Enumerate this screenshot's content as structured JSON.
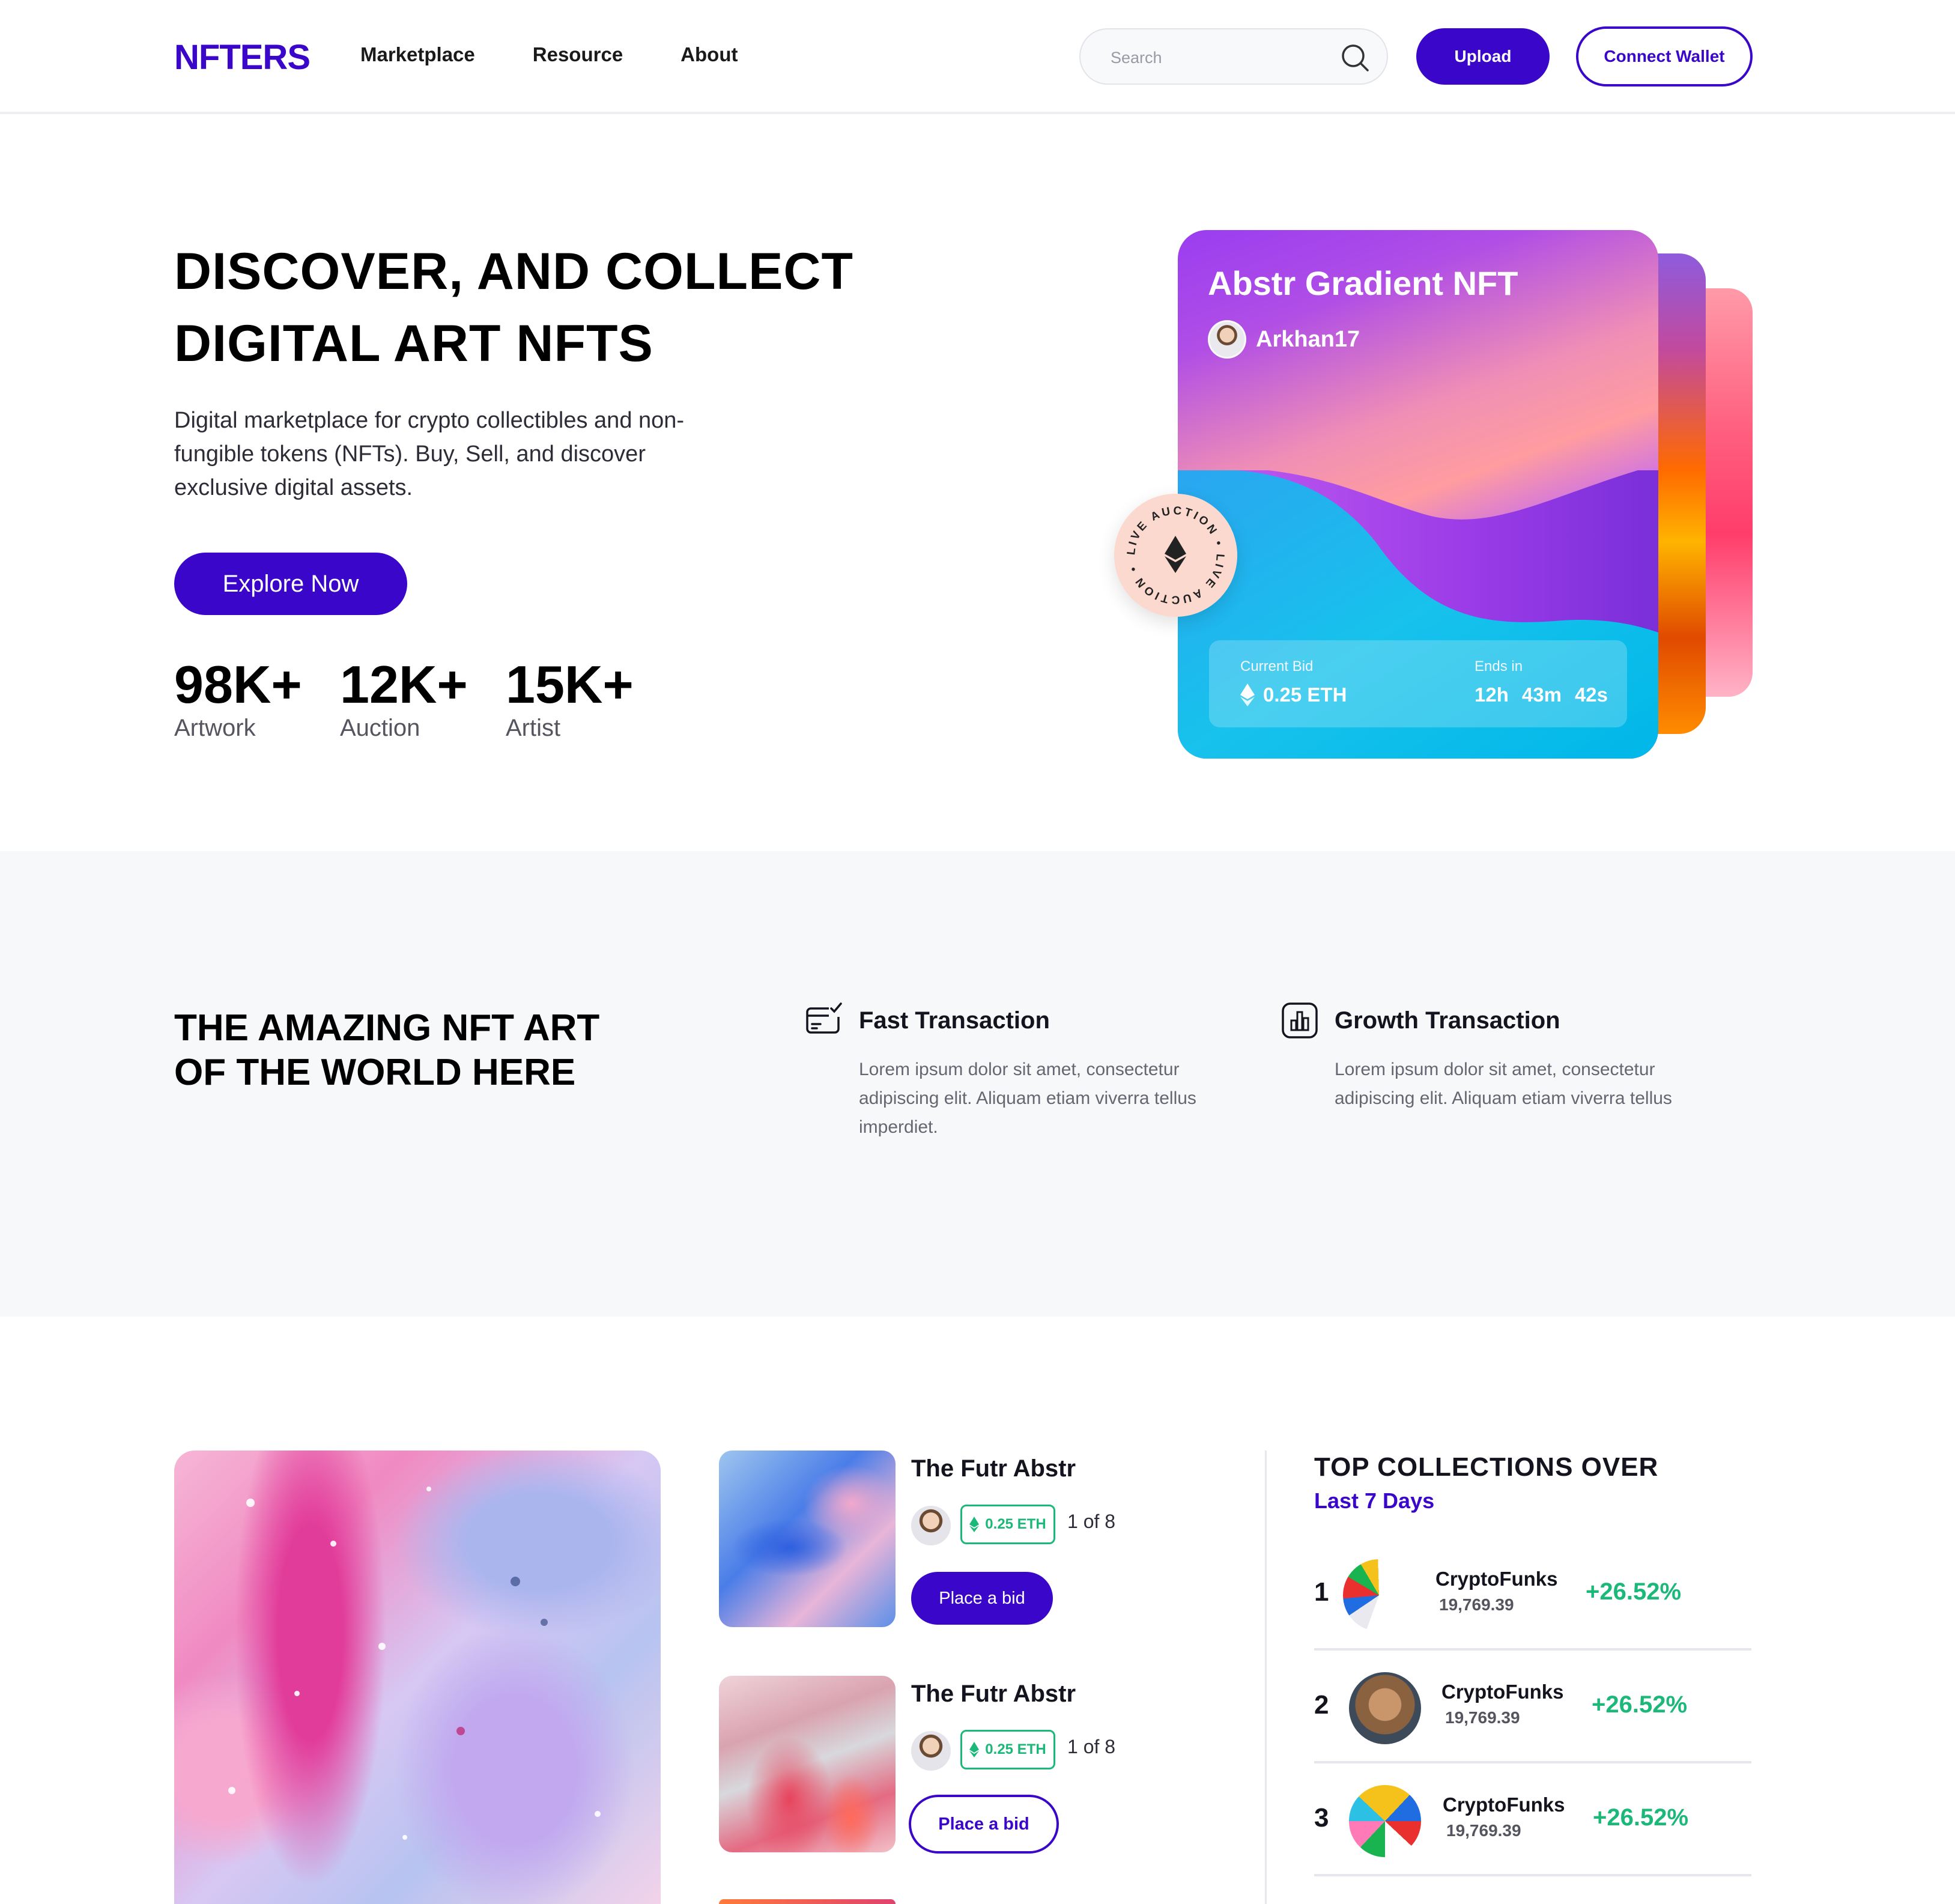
{
  "header": {
    "logo": "NFTERS",
    "nav": [
      "Marketplace",
      "Resource",
      "About"
    ],
    "search_placeholder": "Search",
    "upload_label": "Upload",
    "wallet_label": "Connect Wallet",
    "brand_color": "#3a06c9"
  },
  "hero": {
    "title_line1": "DISCOVER, AND COLLECT",
    "title_line2": "DIGITAL ART NFTS",
    "description": "Digital marketplace for crypto collectibles and non-fungible tokens (NFTs). Buy, Sell, and discover exclusive digital assets.",
    "cta_label": "Explore Now",
    "stats": [
      {
        "value": "98K+",
        "label": "Artwork"
      },
      {
        "value": "12K+",
        "label": "Auction"
      },
      {
        "value": "15K+",
        "label": "Artist"
      }
    ],
    "card": {
      "title": "Abstr Gradient NFT",
      "username": "Arkhan17",
      "current_bid_label": "Current Bid",
      "current_bid_value": "0.25 ETH",
      "ends_label": "Ends in",
      "ends_h": "12h",
      "ends_m": "43m",
      "ends_s": "42s",
      "badge_text": "LIVE AUCTION • LIVE AUCTION •"
    }
  },
  "features": {
    "title_line1": "THE AMAZING NFT ART",
    "title_line2": "OF THE WORLD HERE",
    "items": [
      {
        "name": "Fast Transaction",
        "icon": "card-check-icon",
        "desc": "Lorem ipsum dolor sit amet, consectetur adipiscing elit. Aliquam etiam viverra tellus imperdiet."
      },
      {
        "name": "Growth Transaction",
        "icon": "bar-chart-icon",
        "desc": "Lorem ipsum dolor sit amet, consectetur adipiscing elit. Aliquam etiam viverra tellus"
      }
    ]
  },
  "nft_list": [
    {
      "name": "The Futr Abstr",
      "price": "0.25 ETH",
      "count": "1 of 8",
      "bid_label": "Place a bid"
    },
    {
      "name": "The Futr Abstr",
      "price": "0.25 ETH",
      "count": "1 of 8",
      "bid_label": "Place a bid"
    }
  ],
  "top_collections": {
    "title": "TOP COLLECTIONS OVER",
    "subtitle": "Last 7 Days",
    "items": [
      {
        "rank": "1",
        "name": "CryptoFunks",
        "volume": "19,769.39",
        "change": "+26.52%"
      },
      {
        "rank": "2",
        "name": "CryptoFunks",
        "volume": "19,769.39",
        "change": "+26.52%"
      },
      {
        "rank": "3",
        "name": "CryptoFunks",
        "volume": "19,769.39",
        "change": "+26.52%"
      }
    ],
    "change_color": "#1cb87a"
  }
}
